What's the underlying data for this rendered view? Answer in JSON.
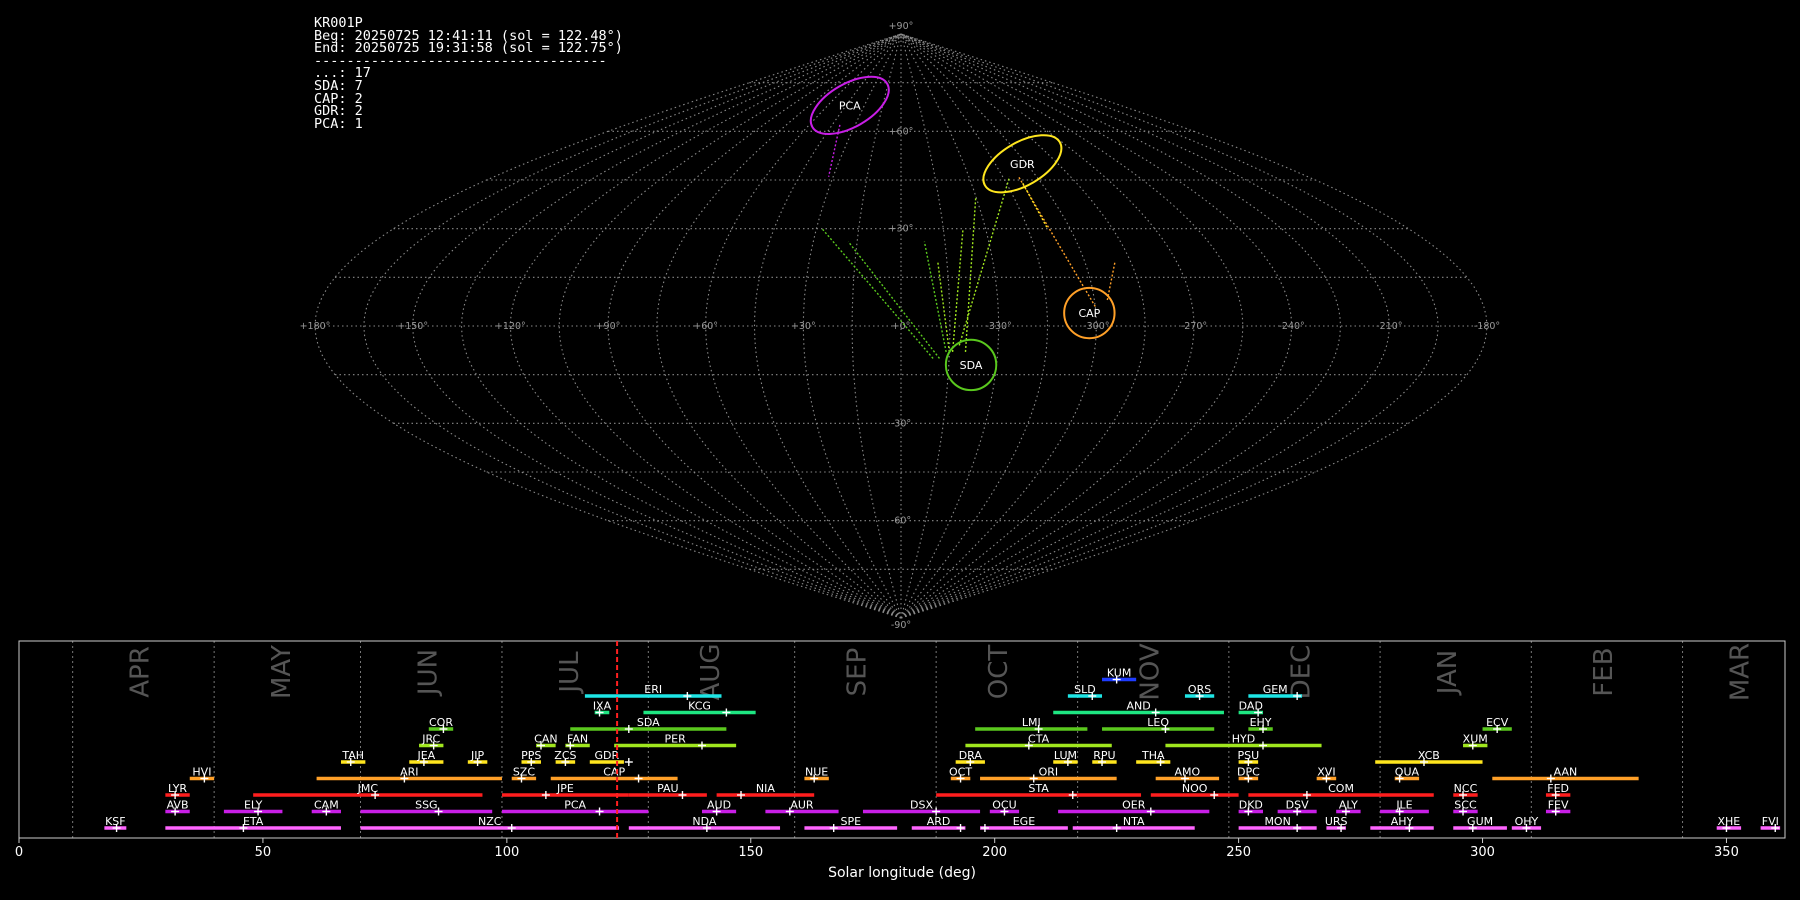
{
  "stats": {
    "station": "KR001P",
    "begin": "Beg: 20250725 12:41:11 (sol = 122.48°)",
    "end": "End: 20250725 19:31:58 (sol = 122.75°)",
    "separator": "------------------------------------",
    "counts": [
      "...: 17",
      "SDA: 7",
      "CAP: 2",
      "GDR: 2",
      "PCA: 1"
    ]
  },
  "chart_data": [
    {
      "type": "scatter",
      "description_note": "sinusoidal sky projection of meteor radiants",
      "lon_labels": [
        "+180°",
        "+150°",
        "+120°",
        "+90°",
        "+60°",
        "+30°",
        "+0°",
        "-330°",
        "-300°",
        "-270°",
        "-240°",
        "-210°",
        "-180°"
      ],
      "lon_values": [
        180,
        150,
        120,
        90,
        60,
        30,
        0,
        -30,
        -60,
        -90,
        -120,
        -150,
        -180
      ],
      "lat_labels": [
        "+90°",
        "+60°",
        "+30°",
        "-30°",
        "-60°",
        "-90°"
      ],
      "lat_values": [
        90,
        60,
        30,
        -30,
        -60,
        -90
      ],
      "radiants": [
        {
          "name": "PCA",
          "lon": 42,
          "lat": 68,
          "rx": 12,
          "ry": 6,
          "color": "#c81ee6"
        },
        {
          "name": "GDR",
          "lon": -58,
          "lat": 50,
          "rx": 12,
          "ry": 6,
          "color": "#ffe61e"
        },
        {
          "name": "SDA",
          "lon": -22,
          "lat": -12,
          "rx": 7,
          "ry": 7,
          "color": "#5ac81e"
        },
        {
          "name": "CAP",
          "lon": -58,
          "lat": 4,
          "rx": 7,
          "ry": 7,
          "color": "#ffa028"
        }
      ],
      "trails": [
        {
          "color": "#a0e61e",
          "from": [
            -15,
            -8
          ],
          "to": [
            -12,
            20
          ]
        },
        {
          "color": "#a0e61e",
          "from": [
            -16,
            -8
          ],
          "to": [
            -22,
            30
          ]
        },
        {
          "color": "#a0e61e",
          "from": [
            -20,
            -8
          ],
          "to": [
            -30,
            40
          ]
        },
        {
          "color": "#a0e61e",
          "from": [
            -18,
            -6
          ],
          "to": [
            -48,
            46
          ]
        },
        {
          "color": "#5ac81e",
          "from": [
            -10,
            -10
          ],
          "to": [
            28,
            30
          ]
        },
        {
          "color": "#5ac81e",
          "from": [
            -12,
            -10
          ],
          "to": [
            18,
            26
          ]
        },
        {
          "color": "#5ac81e",
          "from": [
            -14,
            -8
          ],
          "to": [
            -8,
            26
          ]
        },
        {
          "color": "#ffa028",
          "from": [
            -60,
            6
          ],
          "to": [
            -52,
            46
          ]
        },
        {
          "color": "#ffa028",
          "from": [
            -64,
            8
          ],
          "to": [
            -70,
            20
          ]
        },
        {
          "color": "#c81ee6",
          "from": [
            40,
            62
          ],
          "to": [
            32,
            46
          ]
        },
        {
          "color": "#ffe61e",
          "from": [
            -52,
            44
          ],
          "to": [
            -52,
            30
          ]
        }
      ]
    },
    {
      "type": "bar",
      "xlabel": "Solar longitude (deg)",
      "xlim": [
        0,
        362
      ],
      "xticks": [
        0,
        50,
        100,
        150,
        200,
        250,
        300,
        350
      ],
      "current_sol": 122.6,
      "month_lines": [
        11,
        40,
        70,
        99,
        129,
        159,
        188,
        217,
        248,
        279,
        310,
        341
      ],
      "months": [
        {
          "name": "APR",
          "x": 25
        },
        {
          "name": "MAY",
          "x": 54
        },
        {
          "name": "JUN",
          "x": 84
        },
        {
          "name": "JUL",
          "x": 113
        },
        {
          "name": "AUG",
          "x": 142
        },
        {
          "name": "SEP",
          "x": 172
        },
        {
          "name": "OCT",
          "x": 201
        },
        {
          "name": "NOV",
          "x": 232
        },
        {
          "name": "DEC",
          "x": 263
        },
        {
          "name": "JAN",
          "x": 293
        },
        {
          "name": "FEB",
          "x": 325
        },
        {
          "name": "MAR",
          "x": 353
        }
      ],
      "showers": [
        {
          "code": "KSF",
          "start": 17.5,
          "end": 22,
          "peak": 20,
          "row": 0,
          "color": "#ff64ff"
        },
        {
          "code": "ETA",
          "start": 30,
          "end": 66,
          "peak": 46,
          "row": 0,
          "color": "#ff64ff"
        },
        {
          "code": "NZC",
          "start": 70,
          "end": 123,
          "peak": 101,
          "row": 0,
          "color": "#ff64ff"
        },
        {
          "code": "NDA",
          "start": 125,
          "end": 156,
          "peak": 141,
          "row": 0,
          "color": "#ff64ff"
        },
        {
          "code": "SPE",
          "start": 161,
          "end": 180,
          "peak": 167,
          "row": 0,
          "color": "#ff64ff"
        },
        {
          "code": "ARD",
          "start": 183,
          "end": 194,
          "peak": 193,
          "row": 0,
          "color": "#ff64ff"
        },
        {
          "code": "EGE",
          "start": 197,
          "end": 215,
          "peak": 198,
          "row": 0,
          "color": "#ff64ff"
        },
        {
          "code": "NTA",
          "start": 216,
          "end": 241,
          "peak": 225,
          "row": 0,
          "color": "#ff64ff"
        },
        {
          "code": "MON",
          "start": 250,
          "end": 266,
          "peak": 262,
          "row": 0,
          "color": "#ff64ff"
        },
        {
          "code": "URS",
          "start": 268,
          "end": 272,
          "peak": 271,
          "row": 0,
          "color": "#ff64ff"
        },
        {
          "code": "AHY",
          "start": 277,
          "end": 290,
          "peak": 285,
          "row": 0,
          "color": "#ff64ff"
        },
        {
          "code": "GUM",
          "start": 294,
          "end": 305,
          "peak": 298,
          "row": 0,
          "color": "#ff64ff"
        },
        {
          "code": "OHY",
          "start": 306,
          "end": 312,
          "peak": 309,
          "row": 0,
          "color": "#ff64ff"
        },
        {
          "code": "XHE",
          "start": 348,
          "end": 353,
          "peak": 350,
          "row": 0,
          "color": "#ff64ff"
        },
        {
          "code": "FVI",
          "start": 357,
          "end": 361,
          "peak": 360,
          "row": 0,
          "color": "#ff64ff"
        },
        {
          "code": "AVB",
          "start": 30,
          "end": 35,
          "peak": 32,
          "row": 1,
          "color": "#c81ee6"
        },
        {
          "code": "ELY",
          "start": 42,
          "end": 54,
          "peak": 49,
          "row": 1,
          "color": "#c81ee6"
        },
        {
          "code": "CAM",
          "start": 60,
          "end": 66,
          "peak": 63,
          "row": 1,
          "color": "#c81ee6"
        },
        {
          "code": "SSG",
          "start": 70,
          "end": 97,
          "peak": 86,
          "row": 1,
          "color": "#c81ee6"
        },
        {
          "code": "PCA",
          "start": 99,
          "end": 129,
          "peak": 119,
          "row": 1,
          "color": "#c81ee6"
        },
        {
          "code": "AUD",
          "start": 140,
          "end": 147,
          "peak": 143,
          "row": 1,
          "color": "#c81ee6"
        },
        {
          "code": "AUR",
          "start": 153,
          "end": 168,
          "peak": 158,
          "row": 1,
          "color": "#c81ee6"
        },
        {
          "code": "DSX",
          "start": 173,
          "end": 197,
          "peak": 188,
          "row": 1,
          "color": "#c81ee6"
        },
        {
          "code": "OCU",
          "start": 199,
          "end": 205,
          "peak": 202,
          "row": 1,
          "color": "#c81ee6"
        },
        {
          "code": "OER",
          "start": 213,
          "end": 244,
          "peak": 232,
          "row": 1,
          "color": "#c81ee6"
        },
        {
          "code": "DKD",
          "start": 250,
          "end": 255,
          "peak": 252,
          "row": 1,
          "color": "#c81ee6"
        },
        {
          "code": "DSV",
          "start": 258,
          "end": 266,
          "peak": 262,
          "row": 1,
          "color": "#c81ee6"
        },
        {
          "code": "ALY",
          "start": 270,
          "end": 275,
          "peak": 272,
          "row": 1,
          "color": "#c81ee6"
        },
        {
          "code": "JLE",
          "start": 279,
          "end": 289,
          "peak": 283,
          "row": 1,
          "color": "#c81ee6"
        },
        {
          "code": "SCC",
          "start": 294,
          "end": 299,
          "peak": 296,
          "row": 1,
          "color": "#c81ee6"
        },
        {
          "code": "FEV",
          "start": 313,
          "end": 318,
          "peak": 315,
          "row": 1,
          "color": "#c81ee6"
        },
        {
          "code": "LYR",
          "start": 30,
          "end": 35,
          "peak": 32,
          "row": 2,
          "color": "#ff1e1e"
        },
        {
          "code": "JMC",
          "start": 48,
          "end": 95,
          "peak": 73,
          "row": 2,
          "color": "#ff1e1e"
        },
        {
          "code": "JPE",
          "start": 99,
          "end": 125,
          "peak": 108,
          "row": 2,
          "color": "#ff1e1e"
        },
        {
          "code": "PAU",
          "start": 125,
          "end": 141,
          "peak": 136,
          "row": 2,
          "color": "#ff1e1e"
        },
        {
          "code": "NIA",
          "start": 143,
          "end": 163,
          "peak": 148,
          "row": 2,
          "color": "#ff1e1e"
        },
        {
          "code": "STA",
          "start": 188,
          "end": 230,
          "peak": 216,
          "row": 2,
          "color": "#ff1e1e"
        },
        {
          "code": "NOO",
          "start": 232,
          "end": 250,
          "peak": 245,
          "row": 2,
          "color": "#ff1e1e"
        },
        {
          "code": "COM",
          "start": 252,
          "end": 290,
          "peak": 264,
          "row": 2,
          "color": "#ff1e1e"
        },
        {
          "code": "NCC",
          "start": 294,
          "end": 299,
          "peak": 296,
          "row": 2,
          "color": "#ff1e1e"
        },
        {
          "code": "FED",
          "start": 313,
          "end": 318,
          "peak": 315,
          "row": 2,
          "color": "#ff1e1e"
        },
        {
          "code": "HVI",
          "start": 35,
          "end": 40,
          "peak": 38,
          "row": 3,
          "color": "#ffa028"
        },
        {
          "code": "ARI",
          "start": 61,
          "end": 99,
          "peak": 79,
          "row": 3,
          "color": "#ffa028"
        },
        {
          "code": "SZC",
          "start": 101,
          "end": 106,
          "peak": 103,
          "row": 3,
          "color": "#ffa028"
        },
        {
          "code": "CAP",
          "start": 109,
          "end": 135,
          "peak": 127,
          "row": 3,
          "color": "#ffa028"
        },
        {
          "code": "NUE",
          "start": 161,
          "end": 166,
          "peak": 163,
          "row": 3,
          "color": "#ffa028"
        },
        {
          "code": "OCT",
          "start": 191,
          "end": 195,
          "peak": 193,
          "row": 3,
          "color": "#ffa028"
        },
        {
          "code": "ORI",
          "start": 197,
          "end": 225,
          "peak": 208,
          "row": 3,
          "color": "#ffa028"
        },
        {
          "code": "AMO",
          "start": 233,
          "end": 246,
          "peak": 239,
          "row": 3,
          "color": "#ffa028"
        },
        {
          "code": "DPC",
          "start": 250,
          "end": 254,
          "peak": 252,
          "row": 3,
          "color": "#ffa028"
        },
        {
          "code": "XVI",
          "start": 266,
          "end": 270,
          "peak": 268,
          "row": 3,
          "color": "#ffa028"
        },
        {
          "code": "QUA",
          "start": 282,
          "end": 287,
          "peak": 283,
          "row": 3,
          "color": "#ffa028"
        },
        {
          "code": "AAN",
          "start": 302,
          "end": 332,
          "peak": 314,
          "row": 3,
          "color": "#ffa028"
        },
        {
          "code": "TAH",
          "start": 66,
          "end": 71,
          "peak": 68,
          "row": 4,
          "color": "#ffe61e"
        },
        {
          "code": "JEA",
          "start": 80,
          "end": 87,
          "peak": 83,
          "row": 4,
          "color": "#ffe61e"
        },
        {
          "code": "JIP",
          "start": 92,
          "end": 96,
          "peak": 94,
          "row": 4,
          "color": "#ffe61e"
        },
        {
          "code": "PPS",
          "start": 103,
          "end": 107,
          "peak": 105,
          "row": 4,
          "color": "#ffe61e"
        },
        {
          "code": "ZCS",
          "start": 110,
          "end": 114,
          "peak": 112,
          "row": 4,
          "color": "#ffe61e"
        },
        {
          "code": "GDR",
          "start": 117,
          "end": 124,
          "peak": 125,
          "row": 4,
          "color": "#ffe61e"
        },
        {
          "code": "DRA",
          "start": 192,
          "end": 198,
          "peak": 195,
          "row": 4,
          "color": "#ffe61e"
        },
        {
          "code": "LUM",
          "start": 212,
          "end": 217,
          "peak": 215,
          "row": 4,
          "color": "#ffe61e"
        },
        {
          "code": "RPU",
          "start": 220,
          "end": 225,
          "peak": 222,
          "row": 4,
          "color": "#ffe61e"
        },
        {
          "code": "THA",
          "start": 229,
          "end": 236,
          "peak": 234,
          "row": 4,
          "color": "#ffe61e"
        },
        {
          "code": "PSU",
          "start": 250,
          "end": 254,
          "peak": 252,
          "row": 4,
          "color": "#ffe61e"
        },
        {
          "code": "XCB",
          "start": 278,
          "end": 300,
          "peak": 288,
          "row": 4,
          "color": "#ffe61e"
        },
        {
          "code": "JRC",
          "start": 82,
          "end": 87,
          "peak": 85,
          "row": 5,
          "color": "#a0e61e"
        },
        {
          "code": "CAN",
          "start": 106,
          "end": 110,
          "peak": 107,
          "row": 5,
          "color": "#a0e61e"
        },
        {
          "code": "FAN",
          "start": 112,
          "end": 117,
          "peak": 113,
          "row": 5,
          "color": "#a0e61e"
        },
        {
          "code": "PER",
          "start": 122,
          "end": 147,
          "peak": 140,
          "row": 5,
          "color": "#a0e61e"
        },
        {
          "code": "CTA",
          "start": 194,
          "end": 224,
          "peak": 207,
          "row": 5,
          "color": "#a0e61e"
        },
        {
          "code": "HYD",
          "start": 235,
          "end": 267,
          "peak": 255,
          "row": 5,
          "color": "#a0e61e"
        },
        {
          "code": "XUM",
          "start": 296,
          "end": 301,
          "peak": 298,
          "row": 5,
          "color": "#a0e61e"
        },
        {
          "code": "COR",
          "start": 84,
          "end": 89,
          "peak": 87,
          "row": 6,
          "color": "#5ac81e"
        },
        {
          "code": "SDA",
          "start": 113,
          "end": 145,
          "peak": 125,
          "row": 6,
          "color": "#5ac81e"
        },
        {
          "code": "LMI",
          "start": 196,
          "end": 219,
          "peak": 209,
          "row": 6,
          "color": "#5ac81e"
        },
        {
          "code": "LEO",
          "start": 222,
          "end": 245,
          "peak": 235,
          "row": 6,
          "color": "#5ac81e"
        },
        {
          "code": "EHY",
          "start": 252,
          "end": 257,
          "peak": 255,
          "row": 6,
          "color": "#5ac81e"
        },
        {
          "code": "ECV",
          "start": 300,
          "end": 306,
          "peak": 303,
          "row": 6,
          "color": "#5ac81e"
        },
        {
          "code": "IXA",
          "start": 118,
          "end": 121,
          "peak": 119,
          "row": 7,
          "color": "#1ee682"
        },
        {
          "code": "KCG",
          "start": 128,
          "end": 151,
          "peak": 145,
          "row": 7,
          "color": "#1ee682"
        },
        {
          "code": "AND",
          "start": 212,
          "end": 247,
          "peak": 233,
          "row": 7,
          "color": "#1ee682"
        },
        {
          "code": "DAD",
          "start": 250,
          "end": 255,
          "peak": 254,
          "row": 7,
          "color": "#1ee682"
        },
        {
          "code": "ERI",
          "start": 116,
          "end": 144,
          "peak": 137,
          "row": 8,
          "color": "#1ee6e6"
        },
        {
          "code": "SLD",
          "start": 215,
          "end": 222,
          "peak": 220,
          "row": 8,
          "color": "#1ee6e6"
        },
        {
          "code": "ORS",
          "start": 239,
          "end": 245,
          "peak": 242,
          "row": 8,
          "color": "#1ee6e6"
        },
        {
          "code": "GEM",
          "start": 252,
          "end": 263,
          "peak": 262,
          "row": 8,
          "color": "#1ee6e6"
        },
        {
          "code": "KUM",
          "start": 222,
          "end": 229,
          "peak": 225,
          "row": 9,
          "color": "#1e3cff"
        }
      ]
    }
  ]
}
